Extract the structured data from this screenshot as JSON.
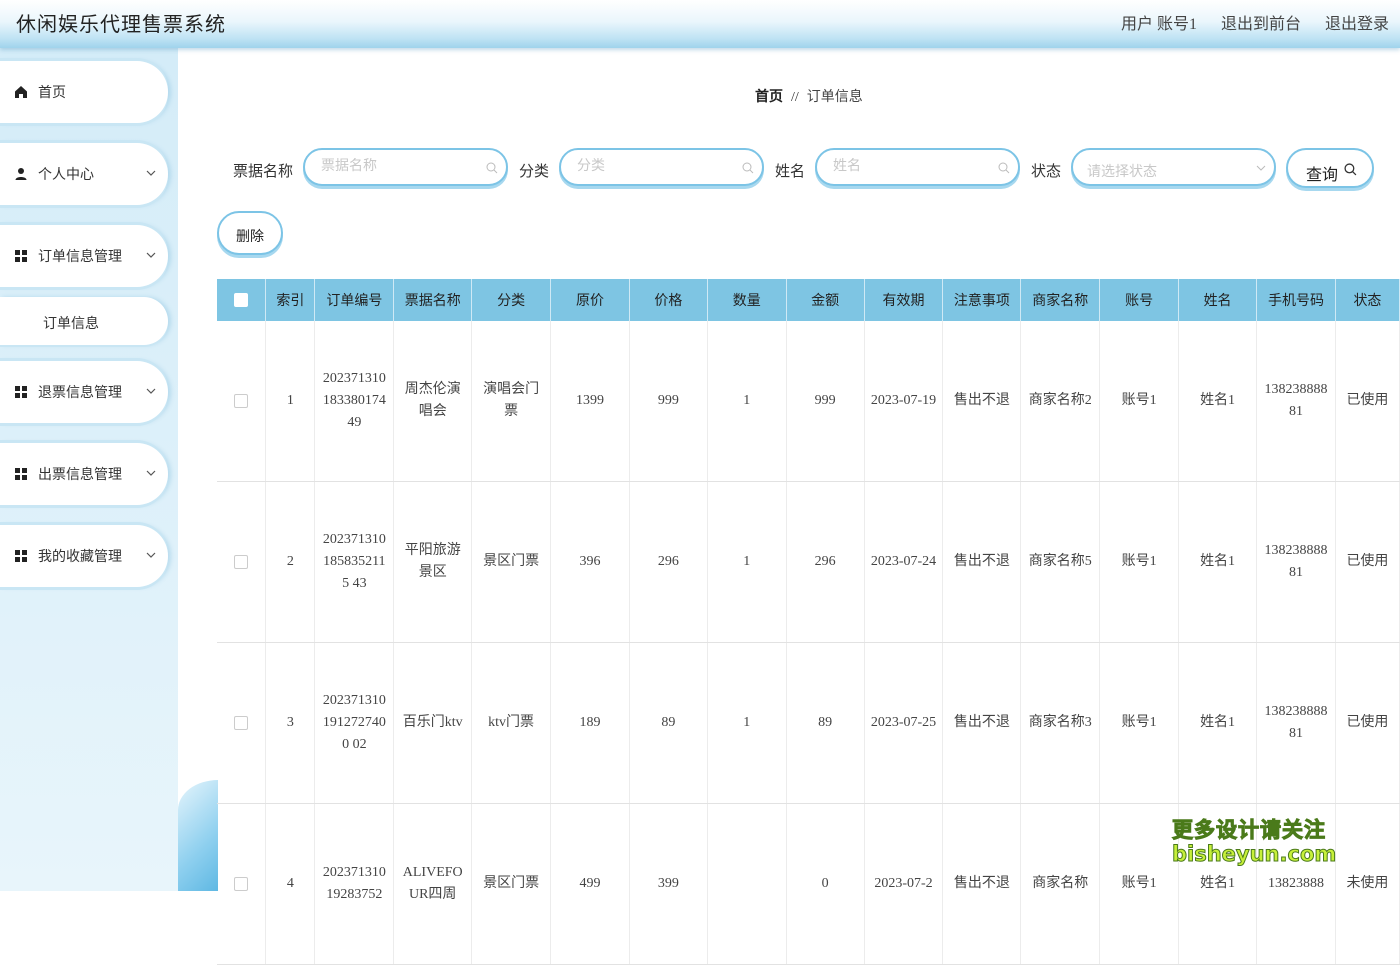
{
  "header": {
    "title": "休闲娱乐代理售票系统",
    "user_text": "用户 账号1",
    "back_link": "退出到前台",
    "logout_link": "退出登录"
  },
  "sidebar": {
    "home": "首页",
    "personal": "个人中心",
    "order_mgmt": "订单信息管理",
    "order_info": "订单信息",
    "refund_mgmt": "退票信息管理",
    "ticket_out_mgmt": "出票信息管理",
    "favorites_mgmt": "我的收藏管理"
  },
  "breadcrumb": {
    "home": "首页",
    "sep": "//",
    "current": "订单信息"
  },
  "filters": {
    "ticket_name_label": "票据名称",
    "ticket_name_placeholder": "票据名称",
    "category_label": "分类",
    "category_placeholder": "分类",
    "name_label": "姓名",
    "name_placeholder": "姓名",
    "status_label": "状态",
    "status_placeholder": "请选择状态",
    "query_button": "查询",
    "delete_button": "删除"
  },
  "table": {
    "headers": [
      "索引",
      "订单编号",
      "票据名称",
      "分类",
      "原价",
      "价格",
      "数量",
      "金额",
      "有效期",
      "注意事项",
      "商家名称",
      "账号",
      "姓名",
      "手机号码",
      "状态"
    ],
    "rows": [
      [
        "1",
        "202371310183380174 49",
        "周杰伦演唱会",
        "演唱会门票",
        "1399",
        "999",
        "1",
        "999",
        "2023-07-19",
        "售出不退",
        "商家名称2",
        "账号1",
        "姓名1",
        "13823888881",
        "已使用"
      ],
      [
        "2",
        "2023713101858352115 43",
        "平阳旅游景区",
        "景区门票",
        "396",
        "296",
        "1",
        "296",
        "2023-07-24",
        "售出不退",
        "商家名称5",
        "账号1",
        "姓名1",
        "13823888881",
        "已使用"
      ],
      [
        "3",
        "2023713101912727400 02",
        "百乐门ktv",
        "ktv门票",
        "189",
        "89",
        "1",
        "89",
        "2023-07-25",
        "售出不退",
        "商家名称3",
        "账号1",
        "姓名1",
        "13823888881",
        "已使用"
      ],
      [
        "4",
        "20237131019283752",
        "ALIVEFOUR四周",
        "景区门票",
        "499",
        "399",
        "",
        "0",
        "2023-07-2",
        "售出不退",
        "商家名称",
        "账号1",
        "姓名1",
        "13823888",
        "未使用"
      ]
    ]
  },
  "watermark": {
    "line1": "更多设计请关注",
    "line2": "bisheyun.com"
  }
}
